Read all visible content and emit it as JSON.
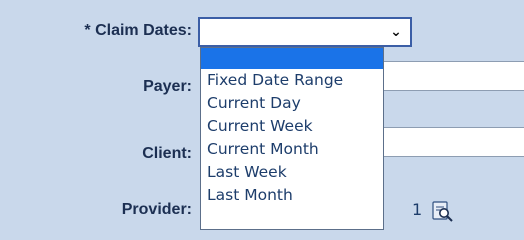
{
  "form": {
    "claim_dates_label": "* Claim Dates:",
    "payer_label": "Payer:",
    "client_label": "Client:",
    "provider_label": "Provider:",
    "claim_dates_value": "",
    "provider_value_fragment": "1"
  },
  "dropdown": {
    "options": [
      "",
      "Fixed Date Range",
      "Current Day",
      "Current Week",
      "Current Month",
      "Last Week",
      "Last Month"
    ],
    "selected_index": 0
  },
  "icons": {
    "select_chevron": "chevron-down-icon",
    "provider_lookup": "lookup-icon"
  },
  "colors": {
    "page_background": "#c9d8eb",
    "label_text": "#1c2f52",
    "option_text": "#1d3d6b",
    "selected_highlight": "#1a73e8",
    "focus_border": "#3b5ea6"
  }
}
